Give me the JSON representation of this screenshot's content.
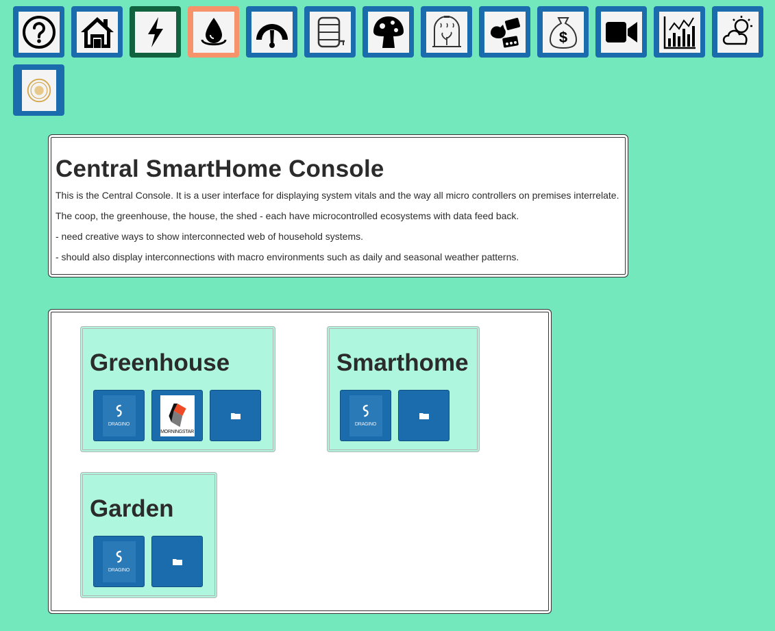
{
  "nav": {
    "items": [
      {
        "icon": "help-icon"
      },
      {
        "icon": "home-icon"
      },
      {
        "icon": "power-icon"
      },
      {
        "icon": "water-icon"
      },
      {
        "icon": "gauge-icon"
      },
      {
        "icon": "water-tank-icon"
      },
      {
        "icon": "mushroom-icon"
      },
      {
        "icon": "greenhouse-icon"
      },
      {
        "icon": "chicken-coop-icon"
      },
      {
        "icon": "money-bag-icon"
      },
      {
        "icon": "video-camera-icon"
      },
      {
        "icon": "analytics-chart-icon"
      },
      {
        "icon": "weather-icon"
      },
      {
        "icon": "about-badge-icon"
      }
    ]
  },
  "intro": {
    "title": "Central SmartHome Console",
    "paragraphs": [
      "This is the Central Console. It is a user interface for displaying system vitals and the way all micro controllers on premises interrelate.",
      "The coop, the greenhouse, the house, the shed - each have microcontrolled ecosystems with data feed back.",
      "- need creative ways to show interconnected web of household systems.",
      "- should also display interconnections with macro environments such as daily and seasonal weather patterns."
    ]
  },
  "systems": {
    "greenhouse": {
      "title": "Greenhouse",
      "devices": [
        {
          "label": "DRAGINO",
          "icon": "dragino-logo-icon"
        },
        {
          "label": "MORNINGSTAR",
          "icon": "morningstar-logo-icon"
        },
        {
          "icon": "folder-icon"
        }
      ]
    },
    "smarthome": {
      "title": "Smarthome",
      "devices": [
        {
          "label": "DRAGINO",
          "icon": "dragino-logo-icon"
        },
        {
          "icon": "folder-icon"
        }
      ]
    },
    "garden": {
      "title": "Garden",
      "devices": [
        {
          "label": "DRAGINO",
          "icon": "dragino-logo-icon"
        },
        {
          "icon": "folder-icon"
        }
      ]
    }
  },
  "colors": {
    "background": "#74e8bd",
    "button_blue": "#1a6cad",
    "button_power": "#11623f",
    "button_water_active": "#f7936b",
    "card_bg": "#aef6dd"
  }
}
